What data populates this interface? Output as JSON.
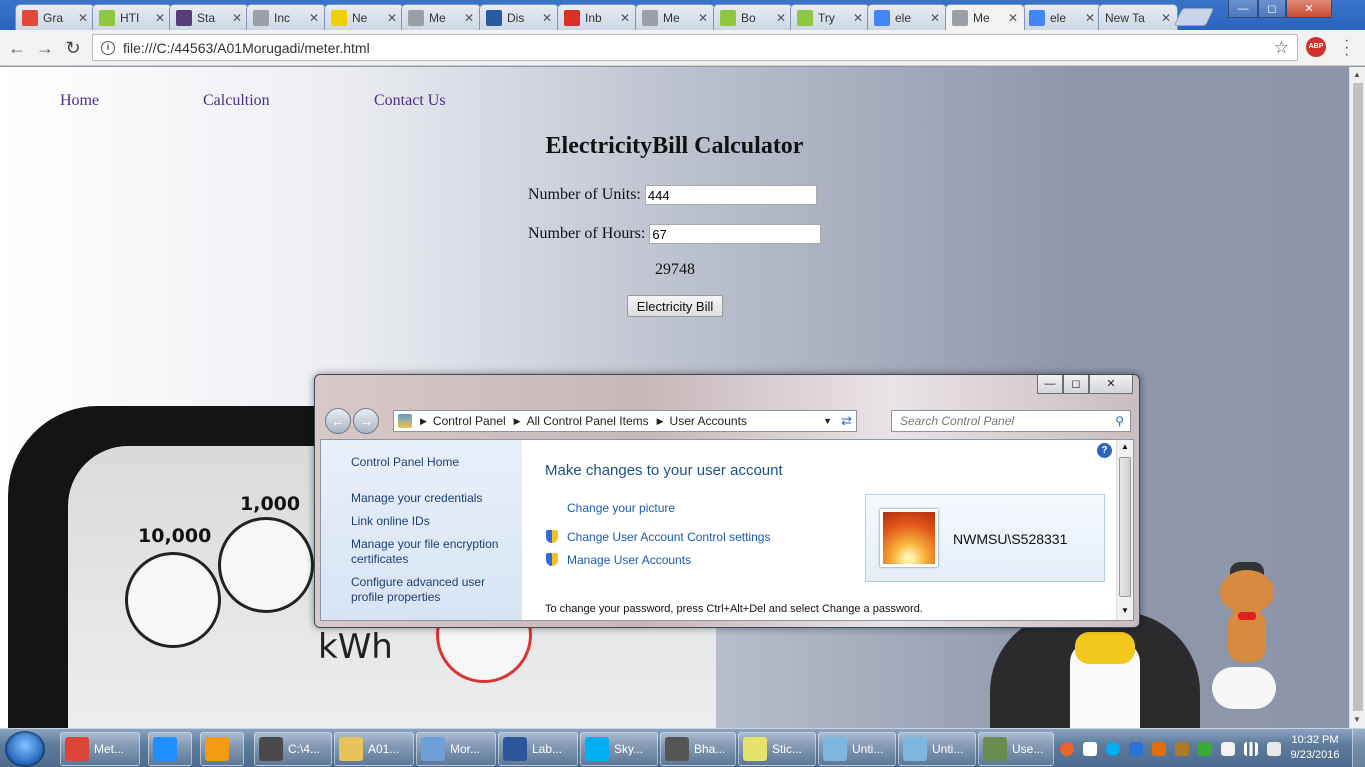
{
  "browser": {
    "tabs": [
      {
        "label": "Gra",
        "icon": "red-spinner-icon",
        "color": "#e0483c",
        "active": false
      },
      {
        "label": "HTI",
        "icon": "w3-icon",
        "color": "#8ec63f",
        "active": false
      },
      {
        "label": "Sta",
        "icon": "bootstrap-icon",
        "color": "#563d7c",
        "active": false
      },
      {
        "label": "Inc",
        "icon": "page-icon",
        "color": "#9aa0a6",
        "active": false
      },
      {
        "label": "Ne",
        "icon": "wd-icon",
        "color": "#f1d000",
        "active": false
      },
      {
        "label": "Me",
        "icon": "page-icon",
        "color": "#9aa0a6",
        "active": false
      },
      {
        "label": "Dis",
        "icon": "hg-icon",
        "color": "#2c5aa0",
        "active": false
      },
      {
        "label": "Inb",
        "icon": "gmail-icon",
        "color": "#d93025",
        "active": false
      },
      {
        "label": "Me",
        "icon": "page-icon",
        "color": "#9aa0a6",
        "active": false
      },
      {
        "label": "Bo",
        "icon": "w3-icon",
        "color": "#8ec63f",
        "active": false
      },
      {
        "label": "Try",
        "icon": "w3-icon",
        "color": "#8ec63f",
        "active": false
      },
      {
        "label": "ele",
        "icon": "google-icon",
        "color": "#4285f4",
        "active": false
      },
      {
        "label": "Me",
        "icon": "page-icon",
        "color": "#9aa0a6",
        "active": true
      },
      {
        "label": "ele",
        "icon": "google-icon",
        "color": "#4285f4",
        "active": false
      },
      {
        "label": "New Ta",
        "icon": "",
        "color": "",
        "active": false
      }
    ],
    "url": "file:///C:/44563/A01Morugadi/meter.html",
    "abp_label": "ABP"
  },
  "page": {
    "nav": {
      "home": "Home",
      "calc": "Calcultion",
      "contact": "Contact Us"
    },
    "title": "ElectricityBill Calculator",
    "units_label": "Number of Units:",
    "units_value": "444",
    "hours_label": "Number of Hours:",
    "hours_value": "67",
    "result": "29748",
    "button_label": "Electricity Bill",
    "meter": {
      "dial1": "10,000",
      "dial2": "1,000",
      "unit": "kWh"
    }
  },
  "control_panel": {
    "breadcrumb": [
      "Control Panel",
      "All Control Panel Items",
      "User Accounts"
    ],
    "search_placeholder": "Search Control Panel",
    "sidebar": {
      "home": "Control Panel Home",
      "credentials": "Manage your credentials",
      "online_ids": "Link online IDs",
      "encryption": "Manage your file encryption certificates",
      "advanced": "Configure advanced user profile properties"
    },
    "heading": "Make changes to your user account",
    "links": {
      "picture": "Change your picture",
      "uac": "Change User Account Control settings",
      "manage": "Manage User Accounts"
    },
    "username": "NWMSU\\S528331",
    "footer": "To change your password, press Ctrl+Alt+Del and select Change a password."
  },
  "taskbar": {
    "items": [
      {
        "label": "Met...",
        "icon": "chrome-icon",
        "color": "#db4437"
      },
      {
        "label": "",
        "icon": "ie-icon",
        "color": "#1e90ff"
      },
      {
        "label": "",
        "icon": "media-player-icon",
        "color": "#f39c12"
      },
      {
        "label": "C:\\4...",
        "icon": "sublime-icon",
        "color": "#4a4a4a"
      },
      {
        "label": "A01...",
        "icon": "folder-icon",
        "color": "#e8c35a"
      },
      {
        "label": "Mor...",
        "icon": "box-icon",
        "color": "#6f9fd8"
      },
      {
        "label": "Lab...",
        "icon": "word-icon",
        "color": "#2b579a"
      },
      {
        "label": "Sky...",
        "icon": "skype-icon",
        "color": "#00aff0"
      },
      {
        "label": "Bha...",
        "icon": "chat-icon",
        "color": "#555555"
      },
      {
        "label": "Stic...",
        "icon": "sticky-notes-icon",
        "color": "#e6e36b"
      },
      {
        "label": "Unti...",
        "icon": "paint-icon",
        "color": "#7fb6e0"
      },
      {
        "label": "Unti...",
        "icon": "paint-icon",
        "color": "#7fb6e0"
      },
      {
        "label": "Use...",
        "icon": "users-icon",
        "color": "#6a8d4f"
      }
    ],
    "time": "10:32 PM",
    "date": "9/23/2016"
  }
}
